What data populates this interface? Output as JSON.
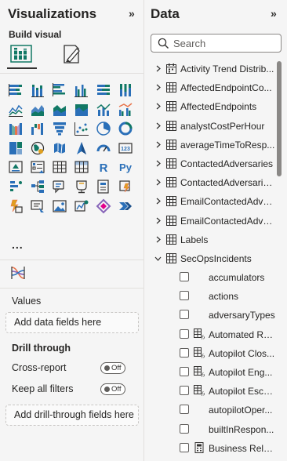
{
  "visualizations": {
    "title": "Visualizations",
    "collapse_glyph": "»",
    "build_visual_label": "Build visual",
    "more_label": "...",
    "visual_types": [
      "stacked-bar-chart-icon",
      "stacked-column-chart-icon",
      "clustered-bar-chart-icon",
      "clustered-column-chart-icon",
      "100-stacked-bar-chart-icon",
      "100-stacked-column-chart-icon",
      "line-chart-icon",
      "area-chart-icon",
      "stacked-area-chart-icon",
      "100-stacked-area-chart-icon",
      "line-and-stacked-column-chart-icon",
      "line-and-clustered-column-chart-icon",
      "ribbon-chart-icon",
      "waterfall-chart-icon",
      "funnel-chart-icon",
      "scatter-chart-icon",
      "pie-chart-icon",
      "donut-chart-icon",
      "treemap-icon",
      "map-icon",
      "filled-map-icon",
      "azure-map-icon",
      "gauge-icon",
      "card-icon",
      "kpi-icon",
      "slicer-icon",
      "table-icon",
      "matrix-icon",
      "r-visual-icon",
      "python-visual-icon",
      "key-influencers-icon",
      "decomposition-tree-icon",
      "qa-icon",
      "narrative-icon",
      "paginated-report-icon",
      "power-apps-icon",
      "power-automate-icon",
      "slicer-alt-icon",
      "image-icon",
      "metrics-icon",
      "power-automate-alt-icon",
      "arrow-chevrons-icon"
    ],
    "values_label": "Values",
    "values_well": "Add data fields here",
    "drill_through_label": "Drill through",
    "cross_report_label": "Cross-report",
    "cross_report_state": "Off",
    "keep_filters_label": "Keep all filters",
    "keep_filters_state": "Off",
    "drill_well": "Add drill-through fields here"
  },
  "data": {
    "title": "Data",
    "collapse_glyph": "»",
    "search_placeholder": "Search",
    "tables": [
      {
        "label": "Activity Trend Distrib...",
        "icon": "calendar-table-icon"
      },
      {
        "label": "AffectedEndpointCo...",
        "icon": "table-icon"
      },
      {
        "label": "AffectedEndpoints",
        "icon": "table-icon"
      },
      {
        "label": "analystCostPerHour",
        "icon": "table-icon"
      },
      {
        "label": "averageTimeToResp...",
        "icon": "table-icon"
      },
      {
        "label": "ContactedAdversaries",
        "icon": "table-icon"
      },
      {
        "label": "ContactedAdversarie...",
        "icon": "table-icon"
      },
      {
        "label": "EmailContactedAdve...",
        "icon": "table-icon"
      },
      {
        "label": "EmailContactedAdve...",
        "icon": "table-icon"
      },
      {
        "label": "Labels",
        "icon": "table-icon"
      }
    ],
    "expanded_table": {
      "label": "SecOpsIncidents",
      "icon": "table-icon"
    },
    "fields": [
      {
        "label": "accumulators",
        "icon": ""
      },
      {
        "label": "actions",
        "icon": ""
      },
      {
        "label": "adversaryTypes",
        "icon": ""
      },
      {
        "label": "Automated Re...",
        "icon": "calculated-column-icon"
      },
      {
        "label": "Autopilot Clos...",
        "icon": "calculated-column-icon"
      },
      {
        "label": "Autopilot Eng...",
        "icon": "calculated-column-icon"
      },
      {
        "label": "Autopilot Esca...",
        "icon": "calculated-column-icon"
      },
      {
        "label": "autopilotOper...",
        "icon": ""
      },
      {
        "label": "builtInRespon...",
        "icon": ""
      },
      {
        "label": "Business Rele...",
        "icon": "calculator-icon"
      }
    ]
  }
}
